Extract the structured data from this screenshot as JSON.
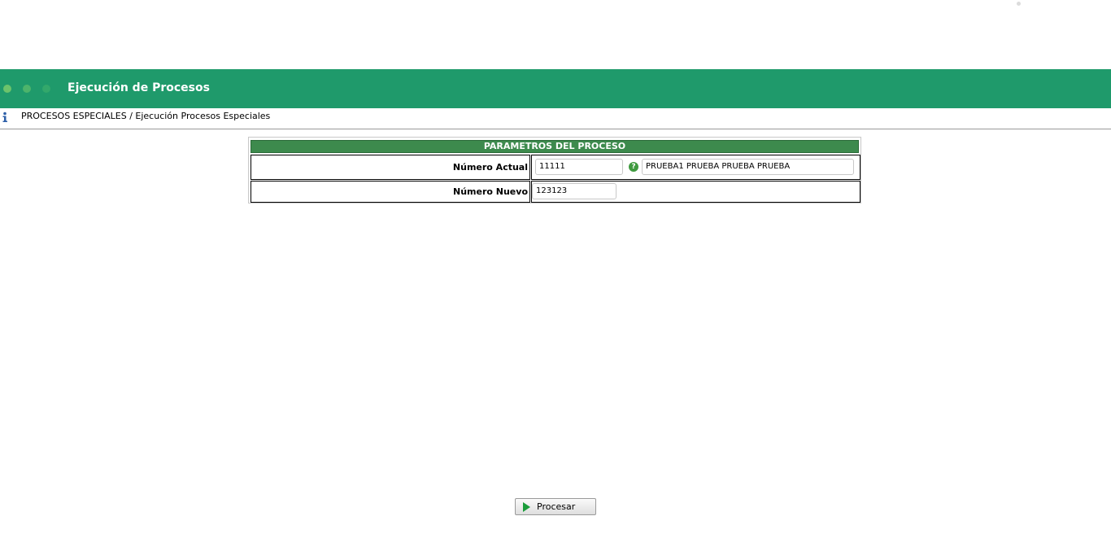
{
  "colors": {
    "header_bg": "#1f9a6b",
    "params_header_bg": "#3d8a4d",
    "play_icon": "#1a9c3a"
  },
  "header": {
    "title": "Ejecución de Procesos"
  },
  "breadcrumb": {
    "icon": "info-icon",
    "text": "PROCESOS ESPECIALES / Ejecución Procesos Especiales"
  },
  "params": {
    "title": "PARAMETROS DEL PROCESO",
    "rows": [
      {
        "label": "Número Actual",
        "value": "11111",
        "help_icon": "help-icon",
        "description": "PRUEBA1 PRUEBA PRUEBA PRUEBA"
      },
      {
        "label": "Número Nuevo",
        "value": "123123"
      }
    ]
  },
  "actions": {
    "process_label": "Procesar",
    "process_icon": "play-icon"
  }
}
